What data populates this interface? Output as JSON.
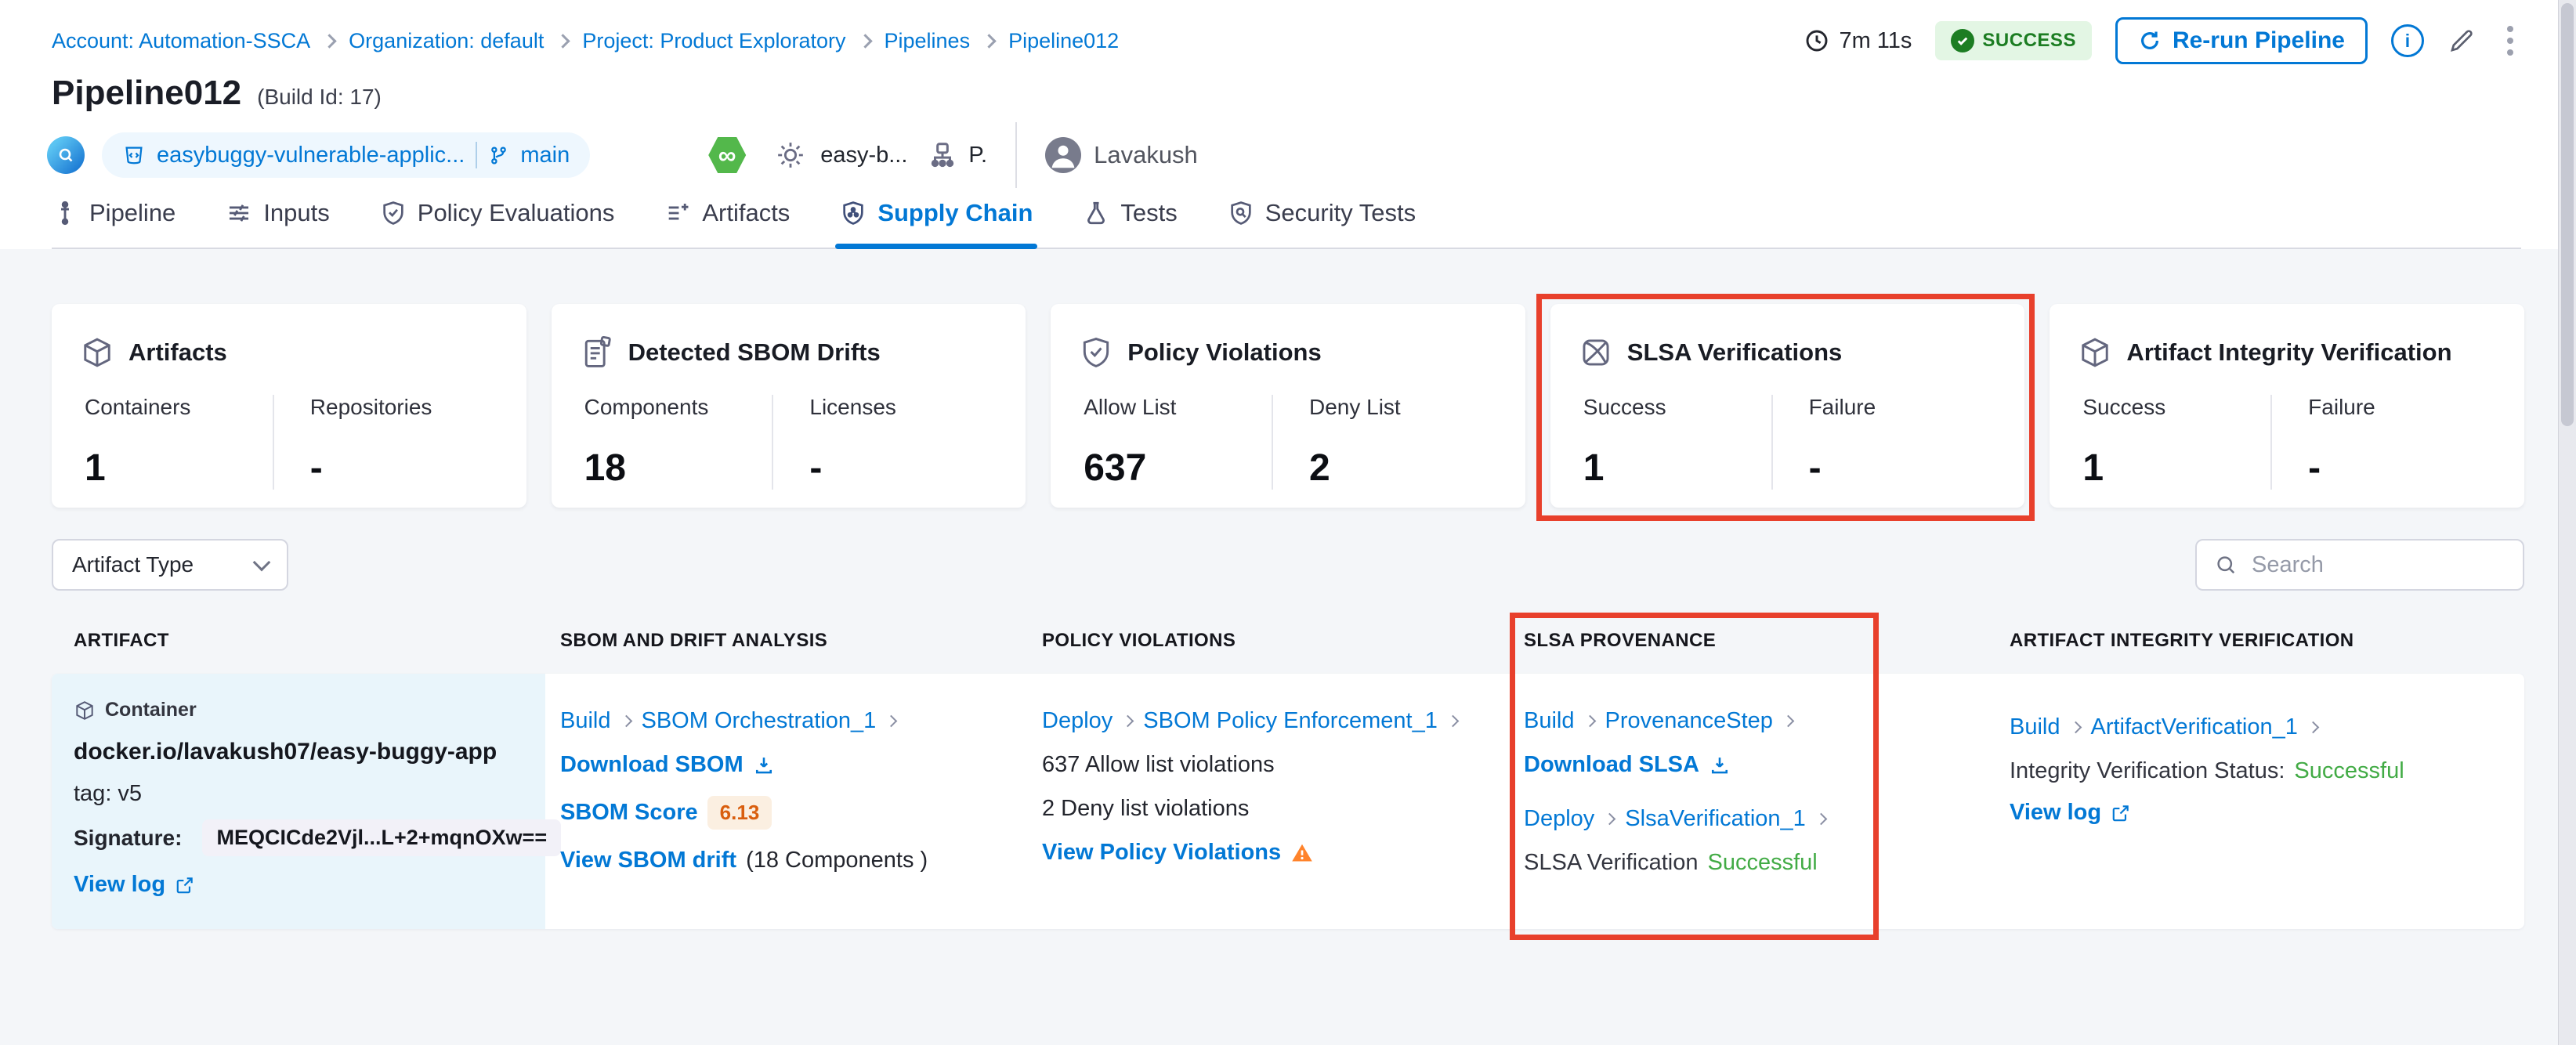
{
  "breadcrumb": {
    "items": [
      "Account: Automation-SSCA",
      "Organization: default",
      "Project: Product Exploratory",
      "Pipelines",
      "Pipeline012"
    ]
  },
  "header": {
    "duration": "7m 11s",
    "status": "SUCCESS",
    "rerun": "Re-run Pipeline",
    "info_glyph": "i",
    "title": "Pipeline012",
    "build_id": "(Build Id: 17)"
  },
  "meta": {
    "repo": "easybuggy-vulnerable-applic...",
    "branch": "main",
    "ci_glyph": "∞",
    "trigger": "easy-b...",
    "delegate_initial": "P.",
    "user": "Lavakush"
  },
  "tabs": [
    {
      "label": "Pipeline"
    },
    {
      "label": "Inputs"
    },
    {
      "label": "Policy Evaluations"
    },
    {
      "label": "Artifacts"
    },
    {
      "label": "Supply Chain"
    },
    {
      "label": "Tests"
    },
    {
      "label": "Security Tests"
    }
  ],
  "cards": [
    {
      "title": "Artifacts",
      "m1_label": "Containers",
      "m1_value": "1",
      "m2_label": "Repositories",
      "m2_value": "-"
    },
    {
      "title": "Detected SBOM Drifts",
      "m1_label": "Components",
      "m1_value": "18",
      "m2_label": "Licenses",
      "m2_value": "-"
    },
    {
      "title": "Policy Violations",
      "m1_label": "Allow List",
      "m1_value": "637",
      "m2_label": "Deny List",
      "m2_value": "2"
    },
    {
      "title": "SLSA Verifications",
      "m1_label": "Success",
      "m1_value": "1",
      "m2_label": "Failure",
      "m2_value": "-"
    },
    {
      "title": "Artifact Integrity Verification",
      "m1_label": "Success",
      "m1_value": "1",
      "m2_label": "Failure",
      "m2_value": "-"
    }
  ],
  "filters": {
    "artifact_type": "Artifact Type",
    "search_placeholder": "Search"
  },
  "table": {
    "headers": [
      "ARTIFACT",
      "SBOM AND DRIFT ANALYSIS",
      "POLICY VIOLATIONS",
      "SLSA PROVENANCE",
      "ARTIFACT INTEGRITY VERIFICATION"
    ],
    "row": {
      "artifact": {
        "type": "Container",
        "name": "docker.io/lavakush07/easy-buggy-app",
        "tag": "tag: v5",
        "signature_label": "Signature:",
        "signature": "MEQCICde2Vjl...L+2+mqnOXw==",
        "view_log": "View log"
      },
      "sbom": {
        "stage": "Build",
        "step": "SBOM Orchestration_1",
        "download": "Download SBOM",
        "score_label": "SBOM Score",
        "score": "6.13",
        "drift_link": "View SBOM drift",
        "drift_suffix": "(18 Components )"
      },
      "policy": {
        "stage": "Deploy",
        "step": "SBOM Policy Enforcement_1",
        "allow": "637 Allow list violations",
        "deny": "2 Deny list violations",
        "view": "View Policy Violations"
      },
      "slsa": {
        "stage1": "Build",
        "step1": "ProvenanceStep",
        "download": "Download SLSA",
        "stage2": "Deploy",
        "step2": "SlsaVerification_1",
        "status_label": "SLSA Verification",
        "status": "Successful"
      },
      "integrity": {
        "stage": "Build",
        "step": "ArtifactVerification_1",
        "status_label": "Integrity Verification Status:",
        "status": "Successful",
        "view_log": "View log"
      }
    }
  }
}
